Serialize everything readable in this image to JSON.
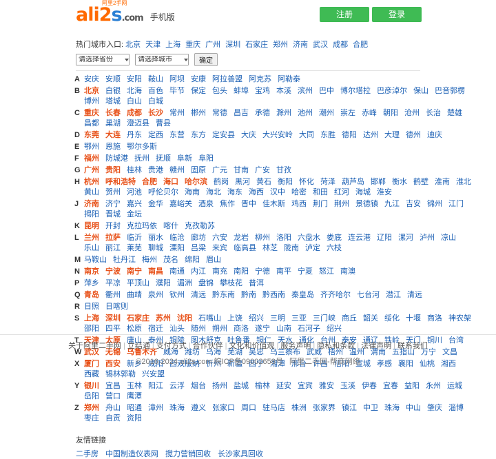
{
  "header": {
    "logo_main": "ali2",
    "logo_s": "s",
    "logo_com": ".com",
    "logo_sup": "阿里2手网",
    "mobile_label": "手机版",
    "register_label": "注册",
    "login_label": "登录"
  },
  "citybar": {
    "label": "热门城市入口:",
    "hot_cities": [
      "北京",
      "天津",
      "上海",
      "重庆",
      "广州",
      "深圳",
      "石家庄",
      "郑州",
      "济南",
      "武汉",
      "成都",
      "合肥"
    ],
    "select_province": "请选择省份",
    "select_city": "请选择城市",
    "go_label": "确定"
  },
  "city_index": [
    {
      "letter": "A",
      "cities": [
        "安庆",
        "安顺",
        "安阳",
        "鞍山",
        "阿坝",
        "安康",
        "阿拉善盟",
        "阿克苏",
        "阿勒泰"
      ]
    },
    {
      "letter": "B",
      "cities": [
        "北京",
        "白银",
        "北海",
        "百色",
        "毕节",
        "保定",
        "包头",
        "蚌埠",
        "宝鸡",
        "本溪",
        "滨州",
        "巴中",
        "博尔塔拉",
        "巴彦淖尔",
        "保山",
        "巴音郭楞",
        "博州",
        "塔城",
        "白山",
        "白城"
      ]
    },
    {
      "letter": "C",
      "cities": [
        "重庆",
        "长春",
        "成都",
        "长沙",
        "常州",
        "郴州",
        "常德",
        "昌吉",
        "承德",
        "滁州",
        "池州",
        "潮州",
        "崇左",
        "赤峰",
        "朝阳",
        "沧州",
        "长治",
        "楚雄",
        "昌都",
        "巢湖",
        "澄迈县",
        "曹县"
      ]
    },
    {
      "letter": "D",
      "cities": [
        "东莞",
        "大连",
        "丹东",
        "定西",
        "东营",
        "东方",
        "定安县",
        "大庆",
        "大兴安岭",
        "大同",
        "东胜",
        "德阳",
        "达州",
        "大理",
        "德州",
        "迪庆"
      ]
    },
    {
      "letter": "E",
      "cities": [
        "鄂州",
        "恩施",
        "鄂尔多斯"
      ]
    },
    {
      "letter": "F",
      "cities": [
        "福州",
        "防城港",
        "抚州",
        "抚顺",
        "阜新",
        "阜阳"
      ]
    },
    {
      "letter": "G",
      "cities": [
        "广州",
        "贵阳",
        "桂林",
        "贵港",
        "赣州",
        "固原",
        "广元",
        "甘南",
        "广安",
        "甘孜"
      ]
    },
    {
      "letter": "H",
      "cities": [
        "杭州",
        "呼和浩特",
        "合肥",
        "海口",
        "哈尔滨",
        "鹤岗",
        "黑河",
        "黄石",
        "衡阳",
        "怀化",
        "菏泽",
        "葫芦岛",
        "邯郸",
        "衡水",
        "鹤壁",
        "淮南",
        "淮北",
        "黄山",
        "贺州",
        "河池",
        "呼伦贝尔",
        "海南",
        "海北",
        "海东",
        "海西",
        "汉中",
        "哈密",
        "和田",
        "红河",
        "海城",
        "淮安"
      ]
    },
    {
      "letter": "J",
      "cities": [
        "济南",
        "济宁",
        "嘉兴",
        "金华",
        "嘉峪关",
        "酒泉",
        "焦作",
        "晋中",
        "佳木斯",
        "鸡西",
        "荆门",
        "荆州",
        "景德镇",
        "九江",
        "吉安",
        "锦州",
        "江门",
        "揭阳",
        "晋城",
        "金坛"
      ]
    },
    {
      "letter": "K",
      "cities": [
        "昆明",
        "开封",
        "克拉玛依",
        "喀什",
        "克孜勒苏"
      ]
    },
    {
      "letter": "L",
      "cities": [
        "兰州",
        "拉萨",
        "临沂",
        "丽水",
        "临沧",
        "廊坊",
        "六安",
        "龙岩",
        "柳州",
        "洛阳",
        "六盘水",
        "娄底",
        "连云港",
        "辽阳",
        "漯河",
        "泸州",
        "凉山",
        "乐山",
        "丽江",
        "莱芜",
        "聊城",
        "溧阳",
        "吕梁",
        "来宾",
        "临高县",
        "林芝",
        "陇南",
        "泸定",
        "六枝"
      ]
    },
    {
      "letter": "M",
      "cities": [
        "马鞍山",
        "牡丹江",
        "梅州",
        "茂名",
        "绵阳",
        "眉山"
      ]
    },
    {
      "letter": "N",
      "cities": [
        "南京",
        "宁波",
        "南宁",
        "南昌",
        "南通",
        "内江",
        "南充",
        "南阳",
        "宁德",
        "南平",
        "宁夏",
        "怒江",
        "南澳"
      ]
    },
    {
      "letter": "P",
      "cities": [
        "萍乡",
        "平凉",
        "平顶山",
        "濮阳",
        "湄洲",
        "盘锦",
        "攀枝花",
        "普洱"
      ]
    },
    {
      "letter": "Q",
      "cities": [
        "青岛",
        "衢州",
        "曲靖",
        "泉州",
        "钦州",
        "清远",
        "黔东南",
        "黔南",
        "黔西南",
        "秦皇岛",
        "齐齐哈尔",
        "七台河",
        "潜江",
        "清远"
      ]
    },
    {
      "letter": "R",
      "cities": [
        "日照",
        "日喀则"
      ]
    },
    {
      "letter": "S",
      "cities": [
        "上海",
        "深圳",
        "石家庄",
        "苏州",
        "沈阳",
        "石嘴山",
        "上饶",
        "绍兴",
        "三明",
        "三亚",
        "三门峡",
        "商丘",
        "韶关",
        "绥化",
        "十堰",
        "商洛",
        "神农架",
        "邵阳",
        "四平",
        "松原",
        "宿迁",
        "汕头",
        "随州",
        "朔州",
        "商洛",
        "遂宁",
        "山南",
        "石河子",
        "绍兴"
      ]
    },
    {
      "letter": "T",
      "cities": [
        "天津",
        "太原",
        "唐山",
        "泰州",
        "铜陵",
        "图木舒克",
        "吐鲁番",
        "铜仁",
        "天水",
        "通化",
        "台州",
        "泰安",
        "通辽",
        "铁岭",
        "天门",
        "铜川",
        "台湾"
      ]
    },
    {
      "letter": "W",
      "cities": [
        "武汉",
        "无锡",
        "乌鲁木齐",
        "威海",
        "潍坊",
        "乌海",
        "芜湖",
        "吴忠",
        "乌兰察布",
        "武威",
        "梧州",
        "温州",
        "渭南",
        "五指山",
        "万宁",
        "文昌"
      ]
    },
    {
      "letter": "X",
      "cities": [
        "厦门",
        "西安",
        "新乡",
        "咸阳",
        "西双版纳",
        "忻州",
        "新疆",
        "西宁",
        "湘潭",
        "邢台",
        "许昌",
        "信阳",
        "宣城",
        "孝感",
        "襄阳",
        "仙桃",
        "湘西",
        "西藏",
        "锡林郭勒",
        "兴安盟"
      ]
    },
    {
      "letter": "Y",
      "cities": [
        "银川",
        "宜昌",
        "玉林",
        "阳江",
        "云浮",
        "烟台",
        "扬州",
        "盐城",
        "榆林",
        "延安",
        "宜宾",
        "雅安",
        "玉溪",
        "伊春",
        "宜春",
        "益阳",
        "永州",
        "运城",
        "岳阳",
        "营口",
        "鹰潭"
      ]
    },
    {
      "letter": "Z",
      "cities": [
        "郑州",
        "舟山",
        "昭通",
        "漳州",
        "珠海",
        "遵义",
        "张家口",
        "周口",
        "驻马店",
        "株洲",
        "张家界",
        "镇江",
        "中卫",
        "珠海",
        "中山",
        "肇庆",
        "淄博",
        "枣庄",
        "自贡",
        "资阳"
      ]
    }
  ],
  "friend": {
    "title": "友情链接",
    "links": [
      "二手房",
      "中国制造仪表网",
      "搅力营销回收",
      "长沙家具回收"
    ]
  },
  "footer": {
    "links": [
      "关于阿里二手网",
      "立结通",
      "支付方式",
      "合作伙伴",
      "文化和价值观",
      "服务声明",
      "隐私和条款",
      "法律声明",
      "联系我们"
    ],
    "copyright_left": "©2016-2024 ali2s.com  皖ICP备09002658号",
    "copyright_right": "阿里二手网-帮商网络"
  }
}
